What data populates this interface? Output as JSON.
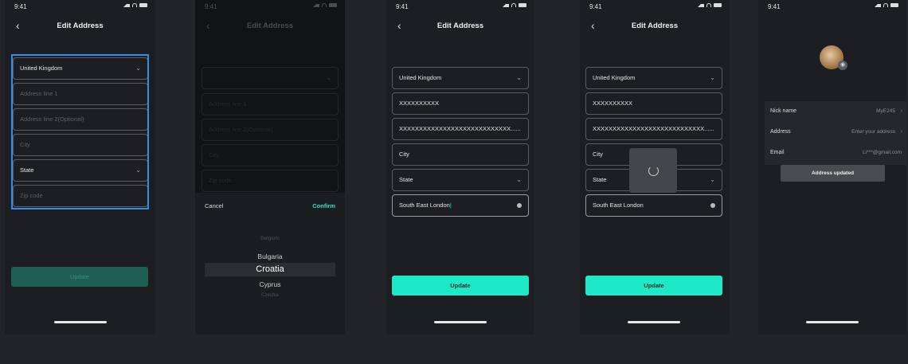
{
  "status": {
    "time": "9:41"
  },
  "nav": {
    "title": "Edit Address",
    "back_icon": "chevron-left-icon"
  },
  "screen1": {
    "country": "United Kingdom",
    "address1_placeholder": "Address line 1",
    "address2_placeholder": "Address line 2(Optional)",
    "city_placeholder": "City",
    "state": "State",
    "zip_placeholder": "Zip code",
    "update_label": "Update"
  },
  "screen2": {
    "address1_placeholder": "Address line 1",
    "address2_placeholder": "Address line 2(Optional)",
    "city_placeholder": "City",
    "zip_placeholder": "Zip code",
    "cancel_label": "Cancel",
    "confirm_label": "Confirm",
    "picker_items": [
      "Belgium",
      "Bulgaria",
      "Croatia",
      "Cyprus",
      "Czechia"
    ],
    "picker_selected": "Croatia"
  },
  "screen3": {
    "country": "United Kingdom",
    "address1": "XXXXXXXXXX",
    "address2": "XXXXXXXXXXXXXXXXXXXXXXXXXXXX......",
    "city": "City",
    "state": "State",
    "zip": "South East London",
    "update_label": "Update"
  },
  "screen4": {
    "country": "United Kingdom",
    "address1": "XXXXXXXXXX",
    "address2": "XXXXXXXXXXXXXXXXXXXXXXXXXXXX......",
    "city": "City",
    "state": "State",
    "zip": "South East London",
    "update_label": "Update"
  },
  "screen5": {
    "rows": [
      {
        "label": "Nick name",
        "value": "MyE245"
      },
      {
        "label": "Address",
        "value": "Enter your address"
      },
      {
        "label": "Email",
        "value": "Li***@gmail.com"
      }
    ],
    "toast": "Address updated"
  },
  "colors": {
    "accent": "#1de9c6",
    "accent_dim": "#1f5e52",
    "highlight": "#2f8fe8",
    "confirm": "#1de9c6"
  }
}
